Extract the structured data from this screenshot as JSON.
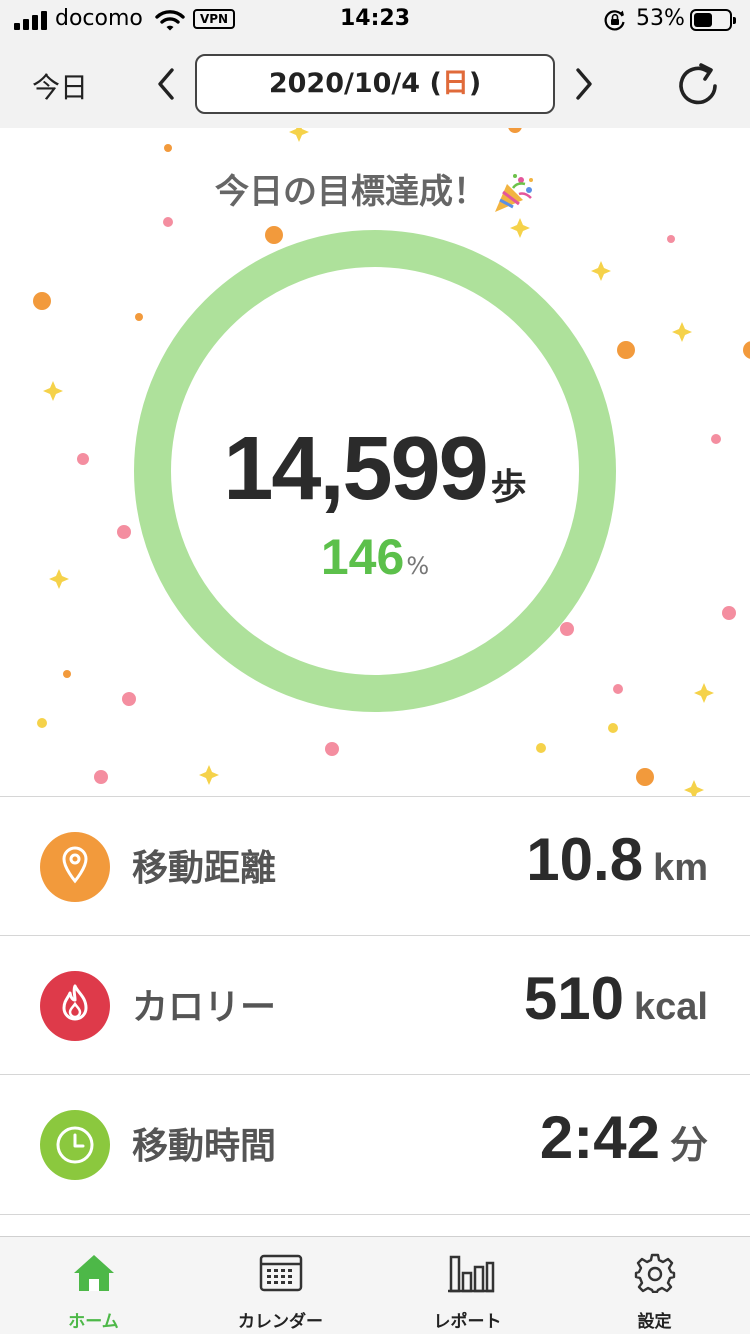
{
  "status_bar": {
    "carrier": "docomo",
    "vpn": "VPN",
    "time": "14:23",
    "battery_pct": "53%",
    "battery_level": 0.53
  },
  "nav": {
    "today": "今日",
    "date_main": "2020/10/4 (",
    "date_dow": "日",
    "date_close": ")"
  },
  "hero": {
    "goal_message": "今日の目標達成！",
    "steps": "14,599",
    "steps_unit": "歩",
    "percent": "146",
    "percent_unit": "%",
    "progress": 1.0
  },
  "stats": [
    {
      "label": "移動距離",
      "value": "10.8",
      "unit": "km",
      "icon": "location-pin-icon",
      "color": "#f29a3c"
    },
    {
      "label": "カロリー",
      "value": "510",
      "unit": "kcal",
      "icon": "flame-icon",
      "color": "#de3a4a"
    },
    {
      "label": "移動時間",
      "value": "2:42",
      "unit": "分",
      "icon": "clock-icon",
      "color": "#8bc83e"
    }
  ],
  "tabs": [
    {
      "label": "ホーム",
      "icon": "home-icon",
      "active": true
    },
    {
      "label": "カレンダー",
      "icon": "calendar-icon",
      "active": false
    },
    {
      "label": "レポート",
      "icon": "bar-chart-icon",
      "active": false
    },
    {
      "label": "設定",
      "icon": "gear-icon",
      "active": false
    }
  ],
  "colors": {
    "ring": "#aee19b",
    "accent_green": "#5cc04b",
    "sunday": "#e06a3a",
    "header_bg": "#f2f2f2"
  }
}
